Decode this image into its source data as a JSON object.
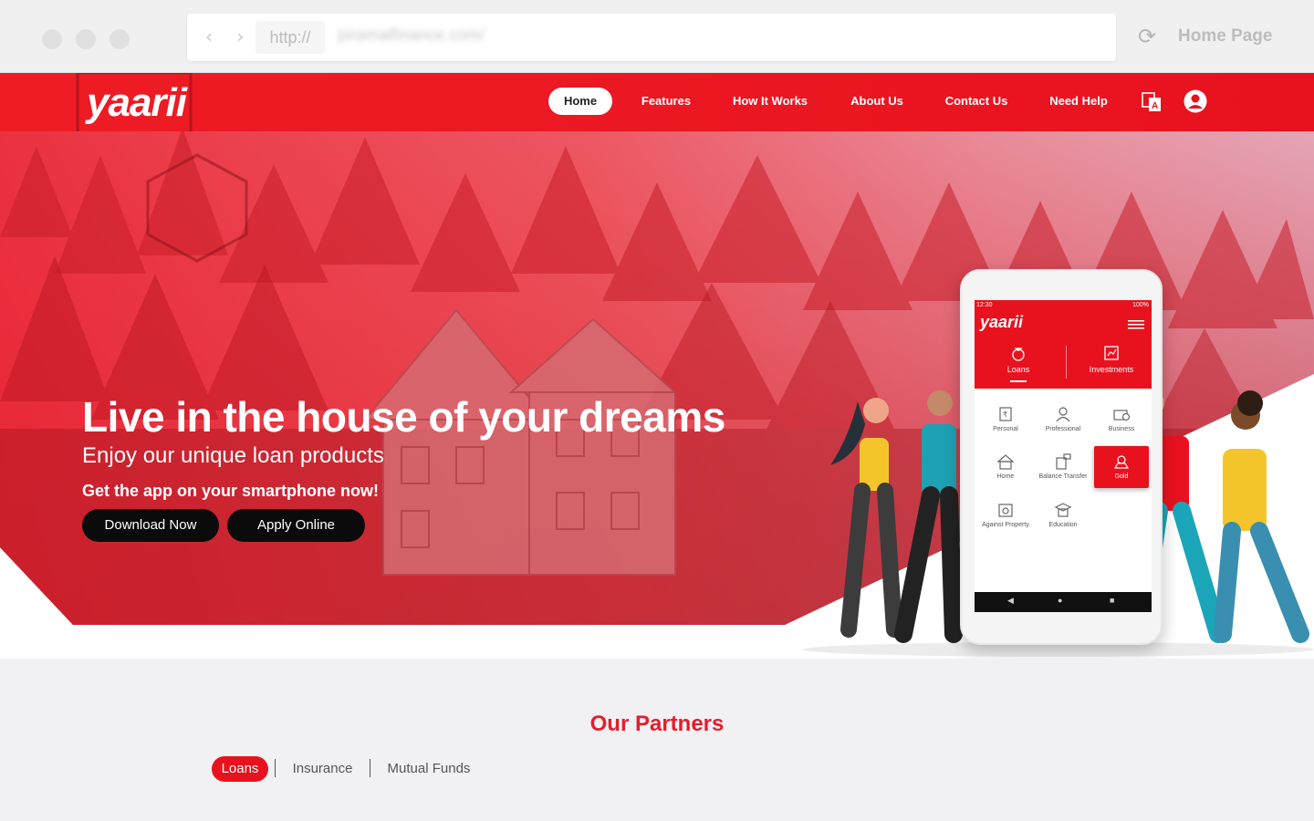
{
  "browser": {
    "protocol": "http://",
    "url": "piramalfinance.com/",
    "page_label": "Home Page"
  },
  "brand": {
    "logo_text": "yaarii",
    "accent": "#e8121e"
  },
  "nav": {
    "items": [
      "Home",
      "Features",
      "How It Works",
      "About Us",
      "Contact Us",
      "Need Help"
    ],
    "active": "Home"
  },
  "hero": {
    "headline": "Live in the house of your dreams",
    "subhead": "Enjoy our unique loan products",
    "cta_text": "Get the app on your smartphone now!",
    "buttons": {
      "download": "Download Now",
      "apply": "Apply Online"
    }
  },
  "phone": {
    "time": "12:30",
    "battery": "100%",
    "logo": "yaarii",
    "tabs": [
      "Loans",
      "Investments"
    ],
    "loan_types": [
      "Personal",
      "Professional",
      "Business",
      "Home",
      "Balance Transfer",
      "Gold",
      "Against Property",
      "Education"
    ],
    "selected": "Gold"
  },
  "partners": {
    "title": "Our Partners",
    "tabs": [
      "Loans",
      "Insurance",
      "Mutual Funds"
    ],
    "active": "Loans"
  }
}
